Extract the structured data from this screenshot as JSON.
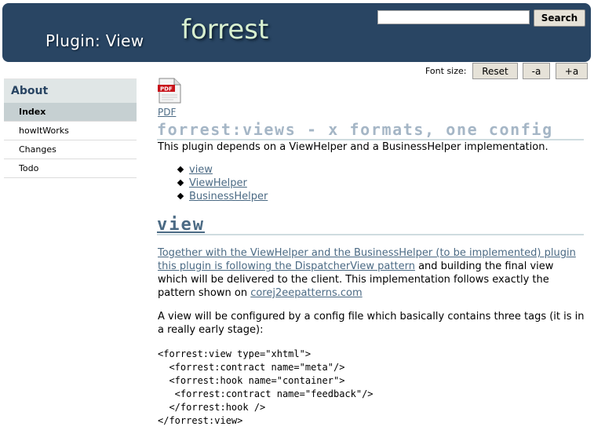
{
  "header": {
    "plugin_title": "Plugin: View",
    "brand": "forrest",
    "search": {
      "value": "",
      "placeholder": "",
      "button_label": "Search"
    }
  },
  "font_size": {
    "label": "Font size:",
    "reset_label": "Reset",
    "decrease_label": "-a",
    "increase_label": "+a"
  },
  "sidebar": {
    "heading": "About",
    "items": [
      {
        "label": "Index",
        "selected": true
      },
      {
        "label": "howItWorks",
        "selected": false
      },
      {
        "label": "Changes",
        "selected": false
      },
      {
        "label": "Todo",
        "selected": false
      }
    ]
  },
  "content": {
    "pdf_icon_text": "PDF",
    "pdf_link": "PDF",
    "title": "forrest:views - x formats, one config",
    "intro": "This plugin depends on a ViewHelper and a BusinessHelper implementation.",
    "toc": [
      "view",
      "ViewHelper",
      "BusinessHelper"
    ],
    "section_title": "view",
    "p1_link": "Together with the ViewHelper and the BusinessHelper (to be implemented) plugin this plugin is following the DispatcherView pattern",
    "p1_text": " and building the final view which will be delivered to the client. This implementation follows exactly the pattern shown on ",
    "p1_link2": "corej2eepatterns.com",
    "p2": "A view will be configured by a config file which basically contains three tags (it is in a really early stage):",
    "code": [
      "<forrest:view type=\"xhtml\">",
      "  <forrest:contract name=\"meta\"/>",
      "  <forrest:hook name=\"container\">",
      "   <forrest:contract name=\"feedback\"/>",
      "  </forrest:hook />",
      "</forrest:view>"
    ]
  },
  "colors": {
    "header_bg": "#294563",
    "link": "#4b6a84",
    "title": "#a5b6c6",
    "sidebar_selected": "#c6d0d2",
    "sidebar_heading_bg": "#e0e6e6"
  }
}
